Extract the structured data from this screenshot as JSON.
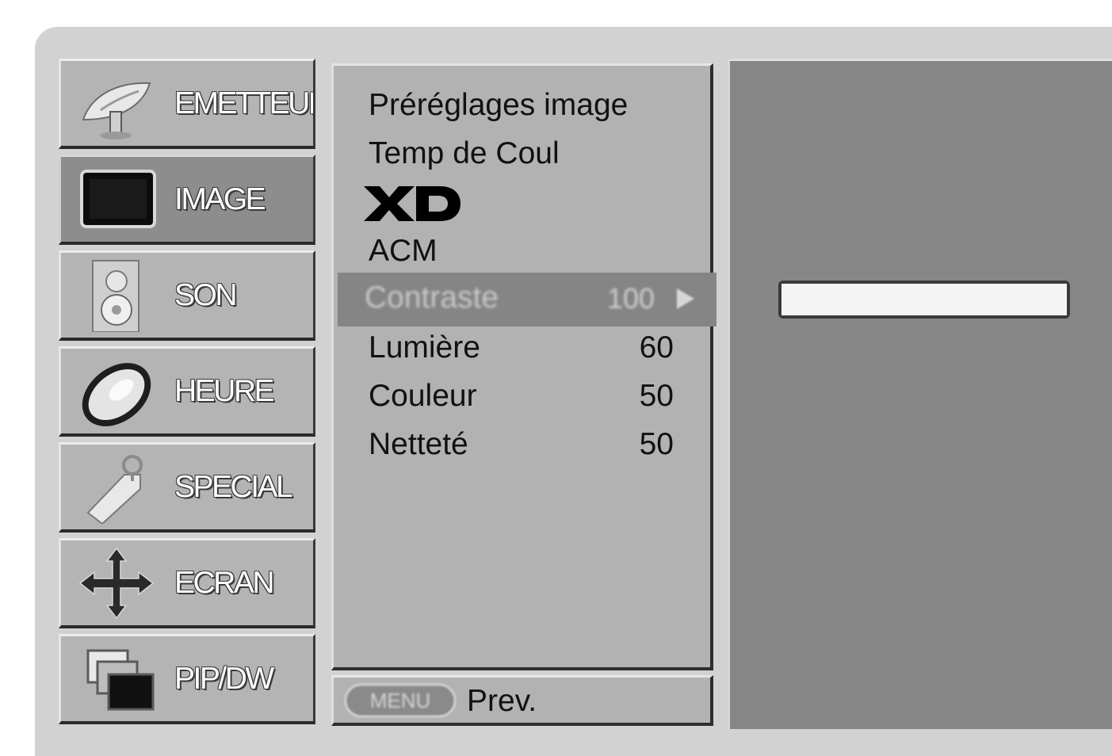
{
  "categories": [
    {
      "label": "EMETTEUR",
      "icon": "satellite-dish-icon"
    },
    {
      "label": "IMAGE",
      "icon": "tv-screen-icon"
    },
    {
      "label": "SON",
      "icon": "speaker-icon"
    },
    {
      "label": "HEURE",
      "icon": "clock-icon"
    },
    {
      "label": "SPECIAL",
      "icon": "tag-icon"
    },
    {
      "label": "ECRAN",
      "icon": "move-arrows-icon"
    },
    {
      "label": "PIP/DW",
      "icon": "pip-windows-icon"
    }
  ],
  "active_category": "IMAGE",
  "submenu": {
    "items": [
      {
        "label": "Préréglages image",
        "value": ""
      },
      {
        "label": "Temp de Coul",
        "value": ""
      },
      {
        "label": "XD",
        "value": ""
      },
      {
        "label": "ACM",
        "value": ""
      },
      {
        "label": "Contraste",
        "value": "100"
      },
      {
        "label": "Lumière",
        "value": "60"
      },
      {
        "label": "Couleur",
        "value": "50"
      },
      {
        "label": "Netteté",
        "value": "50"
      }
    ],
    "selected_index": 4
  },
  "slider": {
    "level": 1.0
  },
  "footer": {
    "menu_button": "MENU",
    "prev_label": "Prev."
  },
  "colors": {
    "frame": "#d2d2d2",
    "category_bg": "#b4b4b4",
    "category_active_bg": "#8d8d8d",
    "submenu_bg": "#b2b2b2",
    "highlight_bg": "#858585",
    "right_panel_bg": "#878787",
    "slider_fill": "#f2f2f2"
  }
}
